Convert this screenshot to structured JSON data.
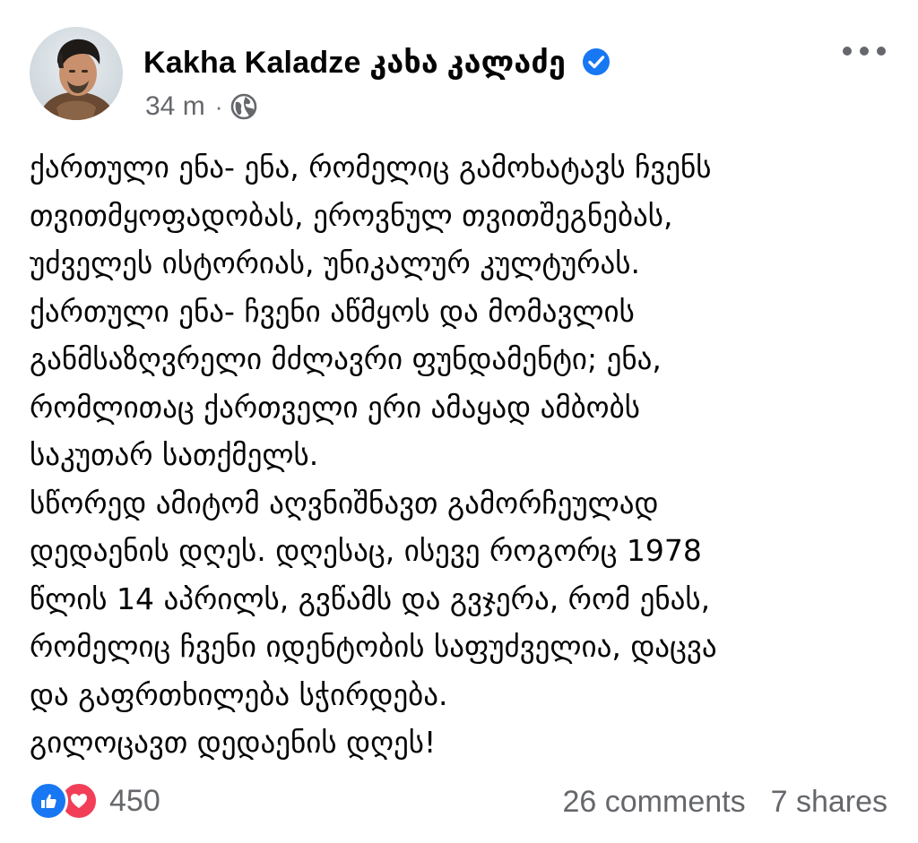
{
  "author": {
    "name": "Kakha Kaladze კახა კალაძე",
    "verified": true
  },
  "meta": {
    "timestamp": "34 m",
    "separator": "·",
    "privacy_icon": "globe-icon"
  },
  "post_text_lines": [
    "ქართული ენა- ენა, რომელიც გამოხატავს  ჩვენს",
    "თვითმყოფადობას, ეროვნულ თვითშეგნებას,",
    "უძველეს ისტორიას, უნიკალურ კულტურას.",
    "ქართული ენა-  ჩვენი აწმყოს და მომავლის",
    "განმსაზღვრელი მძლავრი ფუნდამენტი; ენა,",
    "რომლითაც ქართველი ერი ამაყად ამბობს",
    "საკუთარ სათქმელს.",
    "სწორედ ამიტომ აღვნიშნავთ გამორჩეულად",
    "დედაენის დღეს.  დღესაც, ისევე როგორც 1978",
    "წლის 14 აპრილს,  გვწამს და გვჯერა, რომ ენას,",
    "რომელიც ჩვენი იდენტობის საფუძველია,  დაცვა",
    "და გაფრთხილება სჭირდება.",
    "გილოცავთ დედაენის დღეს!"
  ],
  "footer": {
    "reaction_icons": [
      "like-icon",
      "love-icon"
    ],
    "reaction_count": "450",
    "comments": "26 comments",
    "shares": "7 shares"
  },
  "colors": {
    "text": "#050505",
    "secondary": "#65676b",
    "like_blue": "#1877f2",
    "love_red": "#f33e58",
    "verified_blue": "#1877f2"
  }
}
